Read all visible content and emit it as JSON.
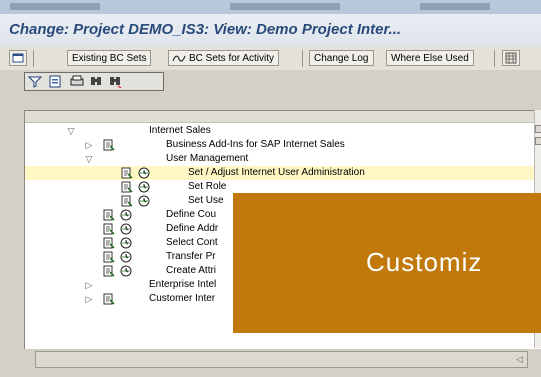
{
  "window": {
    "title": "Change: Project DEMO_IS3: View: Demo Project Inter..."
  },
  "toolbar": {
    "existing_bc_sets": "Existing BC Sets",
    "bc_sets_for_activity": "BC Sets for Activity",
    "change_log": "Change Log",
    "where_else_used": "Where Else Used"
  },
  "tree": {
    "rows": [
      {
        "label": "Internet Sales",
        "expand": "expanded",
        "level": 0
      },
      {
        "label": "Business Add-Ins for SAP Internet Sales",
        "expand": "collapsed",
        "level": 1
      },
      {
        "label": "User Management",
        "expand": "expanded",
        "level": 1
      },
      {
        "label": "Set / Adjust Internet User Administration",
        "level": 2,
        "highlighted": true
      },
      {
        "label": "Set Role",
        "level": 2
      },
      {
        "label": "Set Use",
        "level": 2
      },
      {
        "label": "Define Cou",
        "level": 1
      },
      {
        "label": "Define Addr",
        "level": 1
      },
      {
        "label": "Select Cont",
        "level": 1
      },
      {
        "label": "Transfer Pr",
        "level": 1
      },
      {
        "label": "Create Attri",
        "level": 1
      },
      {
        "label": "Enterprise Intel",
        "expand": "collapsed",
        "level": 0
      },
      {
        "label": "Customer Inter",
        "expand": "collapsed",
        "level": 0
      }
    ]
  },
  "overlay": {
    "text": "Customiz",
    "color": "#c1790c"
  },
  "colors": {
    "title": "#2a4a7a",
    "highlight": "#fff8c4"
  }
}
